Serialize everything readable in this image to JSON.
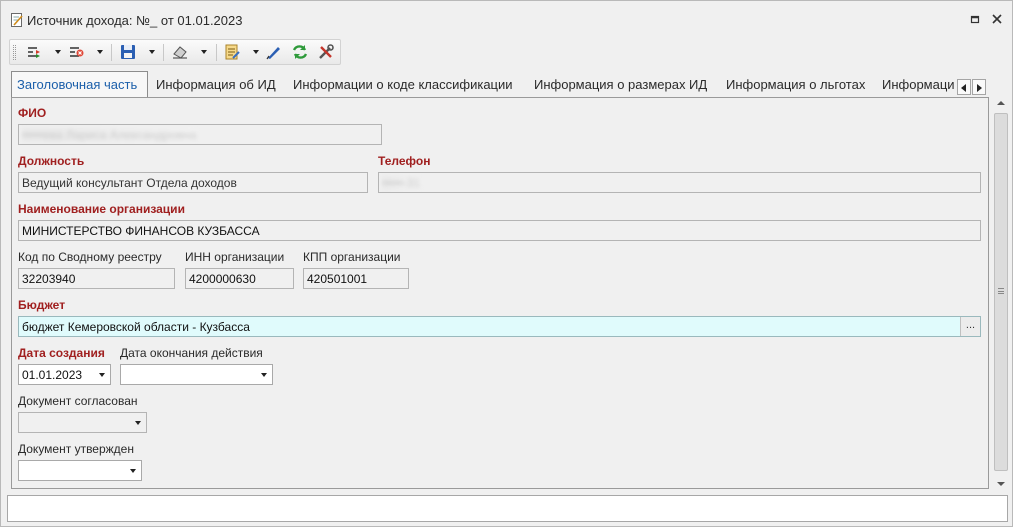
{
  "window": {
    "title": "Источник дохода: №_ от 01.01.2023",
    "restore_glyph": "▫",
    "close_glyph": "✕"
  },
  "toolbar": {
    "buttons": [
      {
        "icon": "actions-icon",
        "has_dropdown": true
      },
      {
        "icon": "delete-action-icon",
        "has_dropdown": true
      },
      {
        "icon": "save-icon",
        "has_dropdown": true
      },
      {
        "icon": "clear-icon",
        "has_dropdown": true
      },
      {
        "icon": "document-icon",
        "has_dropdown": true
      },
      {
        "icon": "edit-icon",
        "has_dropdown": false
      },
      {
        "icon": "refresh-icon",
        "has_dropdown": false
      },
      {
        "icon": "tools-icon",
        "has_dropdown": false
      }
    ]
  },
  "tabs": [
    {
      "label": "Заголовочная часть",
      "active": true
    },
    {
      "label": "Информация об ИД",
      "active": false
    },
    {
      "label": "Информации о коде классификации",
      "active": false
    },
    {
      "label": "Информация о размерах ИД",
      "active": false
    },
    {
      "label": "Информация о льготах",
      "active": false
    },
    {
      "label": "Информаци",
      "active": false
    }
  ],
  "form": {
    "fio": {
      "label": "ФИО",
      "value": "•••••ева Лариса Александровна"
    },
    "position": {
      "label": "Должность",
      "value": "Ведущий консультант Отдела доходов"
    },
    "phone": {
      "label": "Телефон",
      "value": "•••••-31"
    },
    "org_name": {
      "label": "Наименование организации",
      "value": "МИНИСТЕРСТВО ФИНАНСОВ КУЗБАССА"
    },
    "registry_code": {
      "label": "Код по Сводному реестру",
      "value": "32203940"
    },
    "inn": {
      "label": "ИНН организации",
      "value": "4200000630"
    },
    "kpp": {
      "label": "КПП организации",
      "value": "420501001"
    },
    "budget": {
      "label": "Бюджет",
      "value": "бюджет Кемеровской области - Кузбасса",
      "button": "..."
    },
    "created": {
      "label": "Дата создания",
      "value": "01.01.2023"
    },
    "expires": {
      "label": "Дата окончания действия",
      "value": ""
    },
    "agreed": {
      "label": "Документ согласован",
      "value": ""
    },
    "approved": {
      "label": "Документ утвержден",
      "value": ""
    }
  },
  "colors": {
    "required_label": "#a02020",
    "active_tab_text": "#1b5faa",
    "budget_field_bg": "#e0fbfc"
  }
}
